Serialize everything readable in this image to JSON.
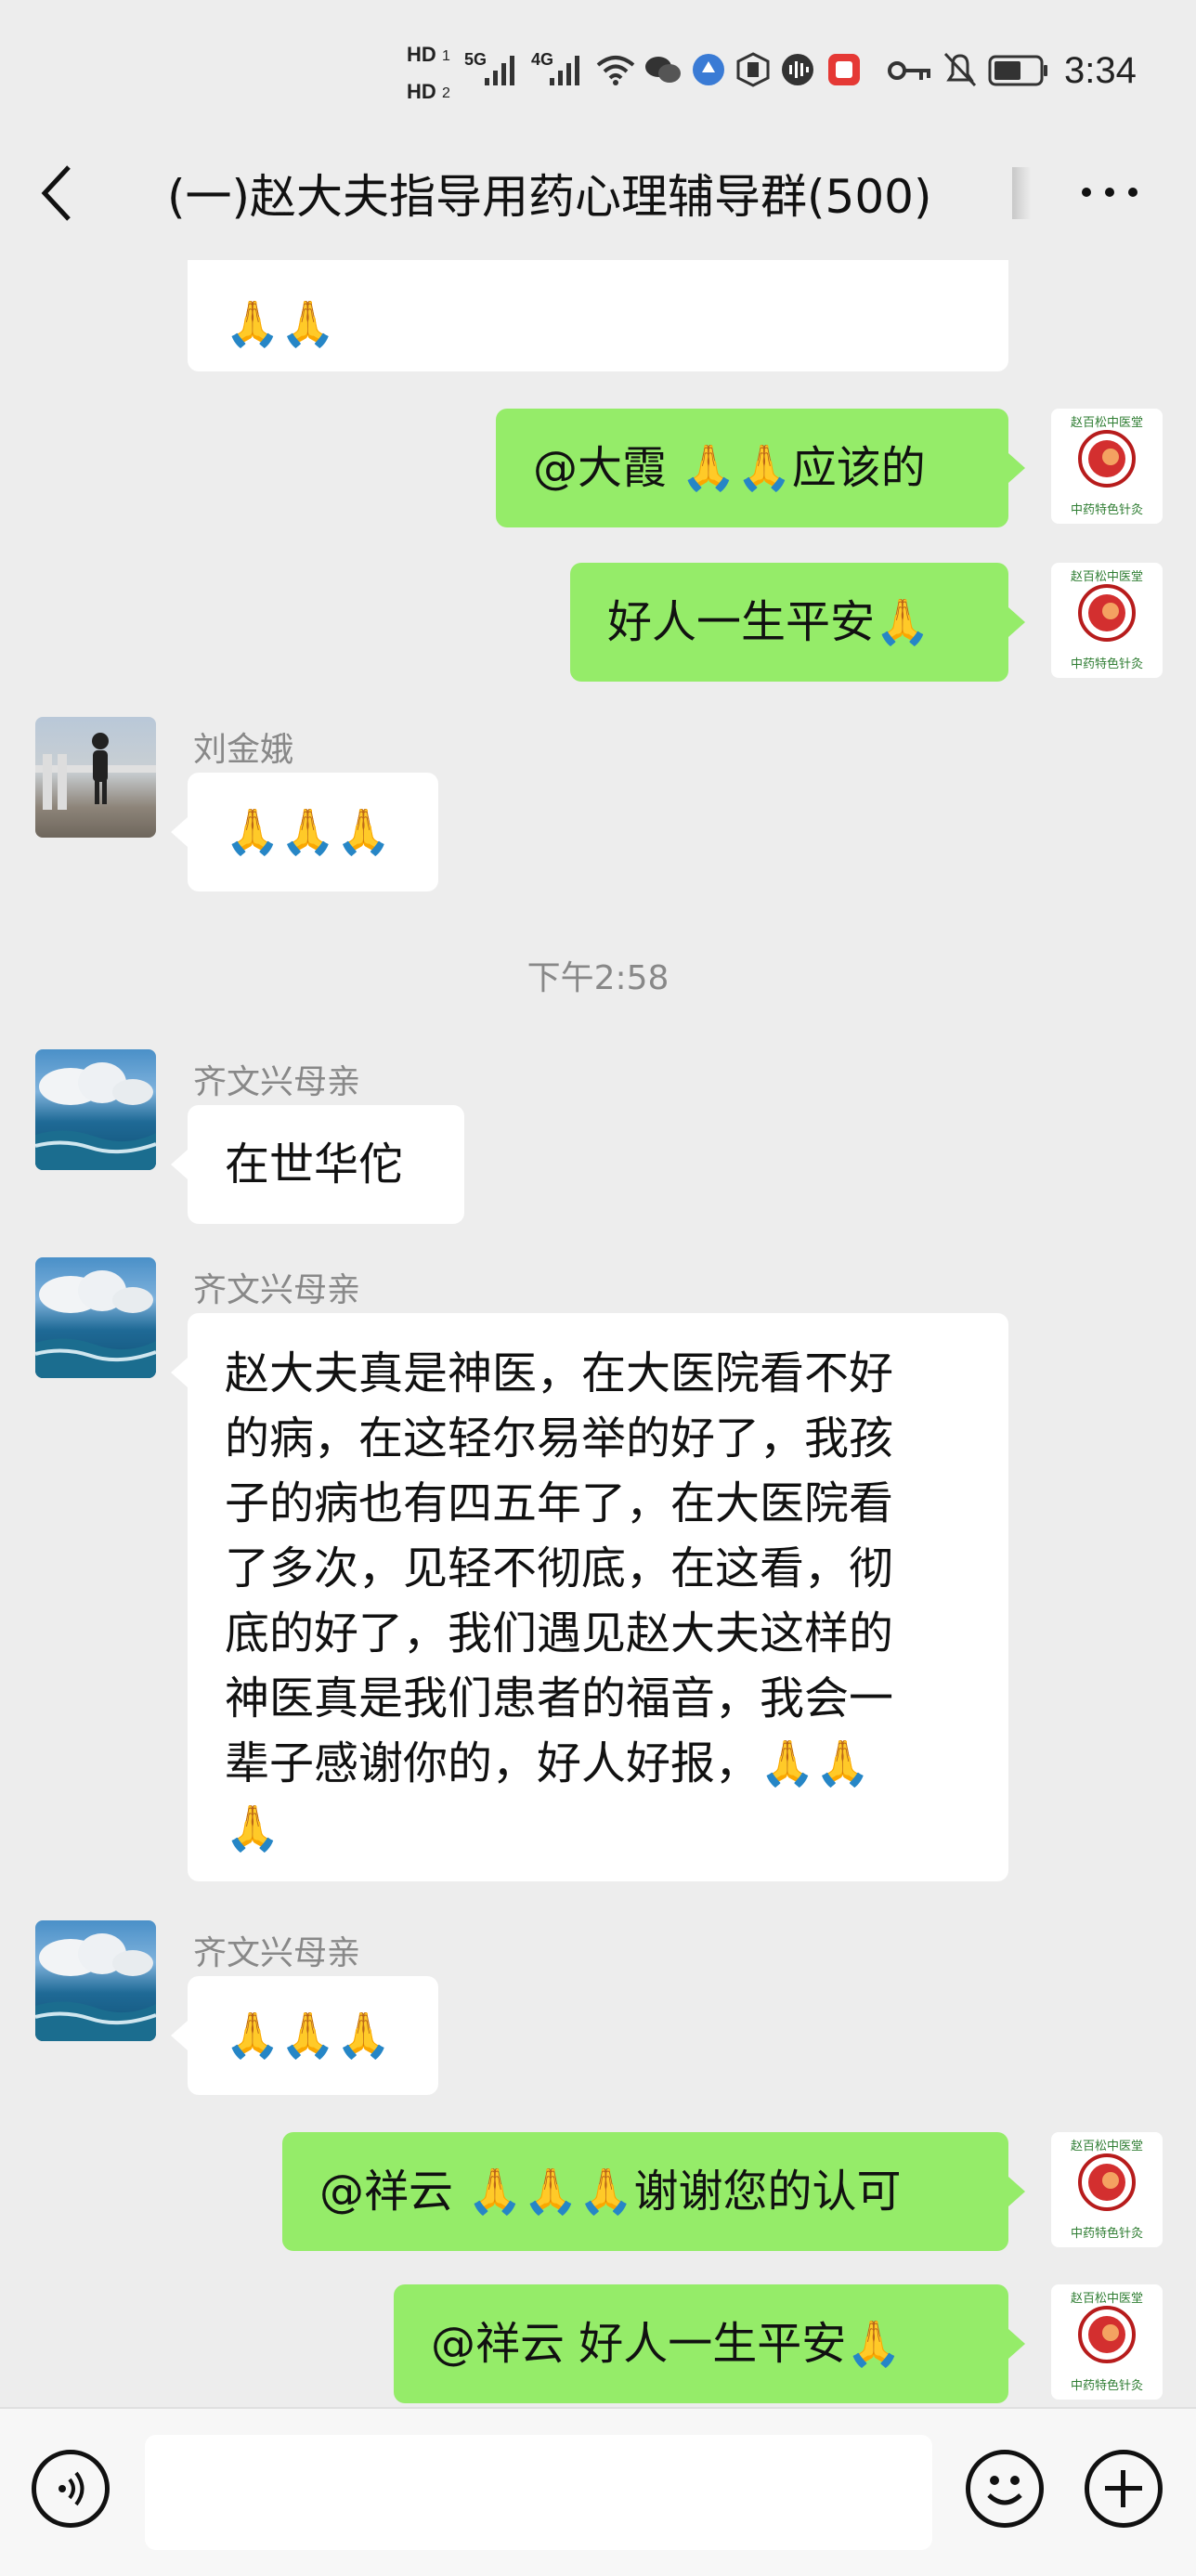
{
  "status_bar": {
    "hd1": "HD",
    "hd2": "HD",
    "sim1": "1",
    "sim2": "2",
    "net1": "5G",
    "net2": "4G",
    "time": "3:34"
  },
  "header": {
    "back_icon": "chevron-left-icon",
    "title": "(一)赵大夫指导用药心理辅导群(500)",
    "more_icon": "more-horizontal-icon"
  },
  "messages": {
    "m0": {
      "text": "🙏🙏"
    },
    "m1": {
      "text": "@大霞  🙏🙏应该的"
    },
    "m2": {
      "text": "好人一生平安🙏"
    },
    "m3": {
      "sender": "刘金娥",
      "text": "🙏🙏🙏"
    },
    "timestamp": "下午2:58",
    "m4": {
      "sender": "齐文兴母亲",
      "text": "在世华佗"
    },
    "m5": {
      "sender": "齐文兴母亲",
      "lines": [
        "赵大夫真是神医，在大医院看不好",
        "的病，在这轻尔易举的好了，我孩",
        "子的病也有四五年了，在大医院看",
        "了多次，见轻不彻底，在这看，彻",
        "底的好了，我们遇见赵大夫这样的",
        "神医真是我们患者的福音，我会一",
        "辈子感谢你的，好人好报，🙏🙏",
        "🙏"
      ]
    },
    "m6": {
      "sender": "齐文兴母亲",
      "text": "🙏🙏🙏"
    },
    "m7": {
      "text": "@祥云  🙏🙏🙏谢谢您的认可"
    },
    "m8": {
      "text": "@祥云  好人一生平安🙏"
    }
  },
  "self_avatar": {
    "top_text": "赵百松中医堂",
    "bottom_text": "中药特色针灸"
  },
  "input_bar": {
    "voice_icon": "voice-icon",
    "emoji_icon": "emoji-icon",
    "add_icon": "plus-circle-icon"
  },
  "colors": {
    "background": "#ededed",
    "bubble_self": "#95ec69",
    "bubble_other": "#ffffff"
  }
}
